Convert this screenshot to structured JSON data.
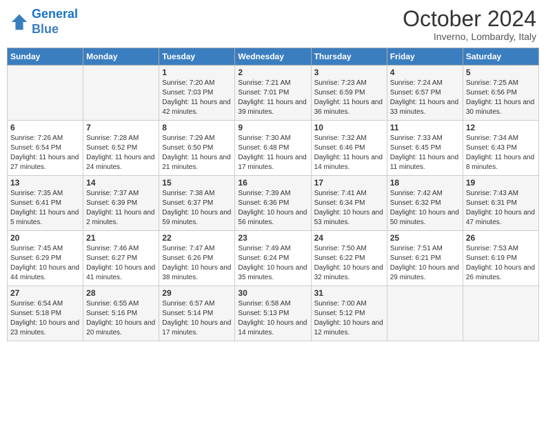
{
  "header": {
    "logo_line1": "General",
    "logo_line2": "Blue",
    "month": "October 2024",
    "location": "Inverno, Lombardy, Italy"
  },
  "days_of_week": [
    "Sunday",
    "Monday",
    "Tuesday",
    "Wednesday",
    "Thursday",
    "Friday",
    "Saturday"
  ],
  "weeks": [
    [
      {
        "day": "",
        "sunrise": "",
        "sunset": "",
        "daylight": ""
      },
      {
        "day": "",
        "sunrise": "",
        "sunset": "",
        "daylight": ""
      },
      {
        "day": "1",
        "sunrise": "Sunrise: 7:20 AM",
        "sunset": "Sunset: 7:03 PM",
        "daylight": "Daylight: 11 hours and 42 minutes."
      },
      {
        "day": "2",
        "sunrise": "Sunrise: 7:21 AM",
        "sunset": "Sunset: 7:01 PM",
        "daylight": "Daylight: 11 hours and 39 minutes."
      },
      {
        "day": "3",
        "sunrise": "Sunrise: 7:23 AM",
        "sunset": "Sunset: 6:59 PM",
        "daylight": "Daylight: 11 hours and 36 minutes."
      },
      {
        "day": "4",
        "sunrise": "Sunrise: 7:24 AM",
        "sunset": "Sunset: 6:57 PM",
        "daylight": "Daylight: 11 hours and 33 minutes."
      },
      {
        "day": "5",
        "sunrise": "Sunrise: 7:25 AM",
        "sunset": "Sunset: 6:56 PM",
        "daylight": "Daylight: 11 hours and 30 minutes."
      }
    ],
    [
      {
        "day": "6",
        "sunrise": "Sunrise: 7:26 AM",
        "sunset": "Sunset: 6:54 PM",
        "daylight": "Daylight: 11 hours and 27 minutes."
      },
      {
        "day": "7",
        "sunrise": "Sunrise: 7:28 AM",
        "sunset": "Sunset: 6:52 PM",
        "daylight": "Daylight: 11 hours and 24 minutes."
      },
      {
        "day": "8",
        "sunrise": "Sunrise: 7:29 AM",
        "sunset": "Sunset: 6:50 PM",
        "daylight": "Daylight: 11 hours and 21 minutes."
      },
      {
        "day": "9",
        "sunrise": "Sunrise: 7:30 AM",
        "sunset": "Sunset: 6:48 PM",
        "daylight": "Daylight: 11 hours and 17 minutes."
      },
      {
        "day": "10",
        "sunrise": "Sunrise: 7:32 AM",
        "sunset": "Sunset: 6:46 PM",
        "daylight": "Daylight: 11 hours and 14 minutes."
      },
      {
        "day": "11",
        "sunrise": "Sunrise: 7:33 AM",
        "sunset": "Sunset: 6:45 PM",
        "daylight": "Daylight: 11 hours and 11 minutes."
      },
      {
        "day": "12",
        "sunrise": "Sunrise: 7:34 AM",
        "sunset": "Sunset: 6:43 PM",
        "daylight": "Daylight: 11 hours and 8 minutes."
      }
    ],
    [
      {
        "day": "13",
        "sunrise": "Sunrise: 7:35 AM",
        "sunset": "Sunset: 6:41 PM",
        "daylight": "Daylight: 11 hours and 5 minutes."
      },
      {
        "day": "14",
        "sunrise": "Sunrise: 7:37 AM",
        "sunset": "Sunset: 6:39 PM",
        "daylight": "Daylight: 11 hours and 2 minutes."
      },
      {
        "day": "15",
        "sunrise": "Sunrise: 7:38 AM",
        "sunset": "Sunset: 6:37 PM",
        "daylight": "Daylight: 10 hours and 59 minutes."
      },
      {
        "day": "16",
        "sunrise": "Sunrise: 7:39 AM",
        "sunset": "Sunset: 6:36 PM",
        "daylight": "Daylight: 10 hours and 56 minutes."
      },
      {
        "day": "17",
        "sunrise": "Sunrise: 7:41 AM",
        "sunset": "Sunset: 6:34 PM",
        "daylight": "Daylight: 10 hours and 53 minutes."
      },
      {
        "day": "18",
        "sunrise": "Sunrise: 7:42 AM",
        "sunset": "Sunset: 6:32 PM",
        "daylight": "Daylight: 10 hours and 50 minutes."
      },
      {
        "day": "19",
        "sunrise": "Sunrise: 7:43 AM",
        "sunset": "Sunset: 6:31 PM",
        "daylight": "Daylight: 10 hours and 47 minutes."
      }
    ],
    [
      {
        "day": "20",
        "sunrise": "Sunrise: 7:45 AM",
        "sunset": "Sunset: 6:29 PM",
        "daylight": "Daylight: 10 hours and 44 minutes."
      },
      {
        "day": "21",
        "sunrise": "Sunrise: 7:46 AM",
        "sunset": "Sunset: 6:27 PM",
        "daylight": "Daylight: 10 hours and 41 minutes."
      },
      {
        "day": "22",
        "sunrise": "Sunrise: 7:47 AM",
        "sunset": "Sunset: 6:26 PM",
        "daylight": "Daylight: 10 hours and 38 minutes."
      },
      {
        "day": "23",
        "sunrise": "Sunrise: 7:49 AM",
        "sunset": "Sunset: 6:24 PM",
        "daylight": "Daylight: 10 hours and 35 minutes."
      },
      {
        "day": "24",
        "sunrise": "Sunrise: 7:50 AM",
        "sunset": "Sunset: 6:22 PM",
        "daylight": "Daylight: 10 hours and 32 minutes."
      },
      {
        "day": "25",
        "sunrise": "Sunrise: 7:51 AM",
        "sunset": "Sunset: 6:21 PM",
        "daylight": "Daylight: 10 hours and 29 minutes."
      },
      {
        "day": "26",
        "sunrise": "Sunrise: 7:53 AM",
        "sunset": "Sunset: 6:19 PM",
        "daylight": "Daylight: 10 hours and 26 minutes."
      }
    ],
    [
      {
        "day": "27",
        "sunrise": "Sunrise: 6:54 AM",
        "sunset": "Sunset: 5:18 PM",
        "daylight": "Daylight: 10 hours and 23 minutes."
      },
      {
        "day": "28",
        "sunrise": "Sunrise: 6:55 AM",
        "sunset": "Sunset: 5:16 PM",
        "daylight": "Daylight: 10 hours and 20 minutes."
      },
      {
        "day": "29",
        "sunrise": "Sunrise: 6:57 AM",
        "sunset": "Sunset: 5:14 PM",
        "daylight": "Daylight: 10 hours and 17 minutes."
      },
      {
        "day": "30",
        "sunrise": "Sunrise: 6:58 AM",
        "sunset": "Sunset: 5:13 PM",
        "daylight": "Daylight: 10 hours and 14 minutes."
      },
      {
        "day": "31",
        "sunrise": "Sunrise: 7:00 AM",
        "sunset": "Sunset: 5:12 PM",
        "daylight": "Daylight: 10 hours and 12 minutes."
      },
      {
        "day": "",
        "sunrise": "",
        "sunset": "",
        "daylight": ""
      },
      {
        "day": "",
        "sunrise": "",
        "sunset": "",
        "daylight": ""
      }
    ]
  ]
}
